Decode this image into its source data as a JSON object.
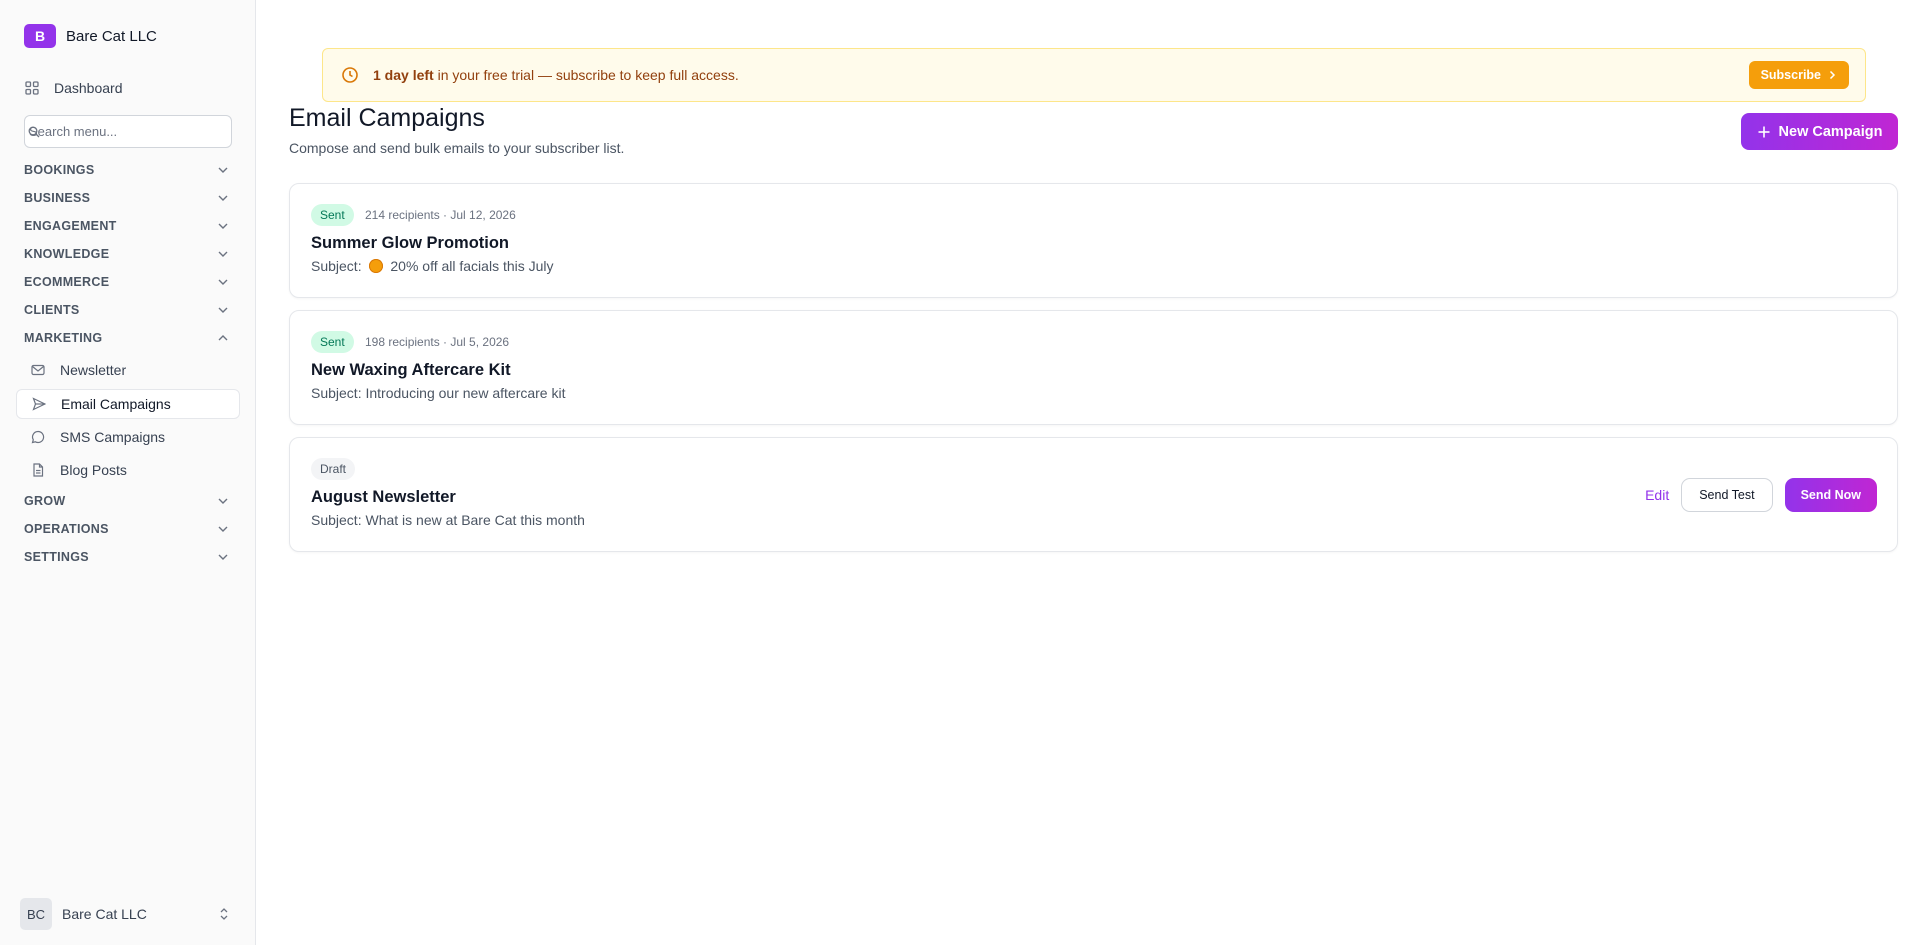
{
  "sidebar": {
    "brand": {
      "initial": "B",
      "name": "Bare Cat LLC",
      "color": "#9333ea"
    },
    "dashboard_label": "Dashboard",
    "search_placeholder": "Search menu...",
    "sections": [
      {
        "label": "BOOKINGS",
        "expanded": false
      },
      {
        "label": "BUSINESS",
        "expanded": false
      },
      {
        "label": "ENGAGEMENT",
        "expanded": false
      },
      {
        "label": "KNOWLEDGE",
        "expanded": false
      },
      {
        "label": "ECOMMERCE",
        "expanded": false
      },
      {
        "label": "CLIENTS",
        "expanded": false
      },
      {
        "label": "MARKETING",
        "expanded": true
      },
      {
        "label": "GROW",
        "expanded": false
      },
      {
        "label": "OPERATIONS",
        "expanded": false
      },
      {
        "label": "SETTINGS",
        "expanded": false
      }
    ],
    "marketing_items": [
      {
        "label": "Newsletter",
        "icon": "mail-icon"
      },
      {
        "label": "Email Campaigns",
        "icon": "send-icon",
        "active": true
      },
      {
        "label": "SMS Campaigns",
        "icon": "message-circle-icon"
      },
      {
        "label": "Blog Posts",
        "icon": "file-text-icon"
      }
    ],
    "footer": {
      "initials": "BC",
      "name": "Bare Cat LLC"
    }
  },
  "trial_banner": {
    "bold": "1 day left",
    "text": " in your free trial — subscribe to keep full access.",
    "button_label": "Subscribe"
  },
  "header": {
    "title": "Email Campaigns",
    "subtitle": "Compose and send bulk emails to your subscriber list.",
    "new_button_label": "New Campaign"
  },
  "campaigns": [
    {
      "status": "Sent",
      "meta": "214 recipients · Jul 12, 2026",
      "title": "Summer Glow Promotion",
      "subject_label": "Subject:",
      "subject": "20% off all facials this July",
      "has_emoji": true
    },
    {
      "status": "Sent",
      "meta": "198 recipients · Jul 5, 2026",
      "title": "New Waxing Aftercare Kit",
      "subject_label": "Subject:",
      "subject": "Introducing our new aftercare kit",
      "has_emoji": false
    },
    {
      "status": "Draft",
      "meta": "",
      "title": "August Newsletter",
      "subject_label": "Subject:",
      "subject": "What is new at Bare Cat this month",
      "has_emoji": false,
      "actions": {
        "edit": "Edit",
        "send_test": "Send Test",
        "send_now": "Send Now"
      }
    }
  ],
  "colors": {
    "accent": "#9333ea",
    "accent_end": "#c026d3",
    "sent_badge_bg": "#d1fae5",
    "sent_badge_text": "#047857",
    "trial_bg": "#fffbeb",
    "trial_button": "#f59e0b"
  }
}
